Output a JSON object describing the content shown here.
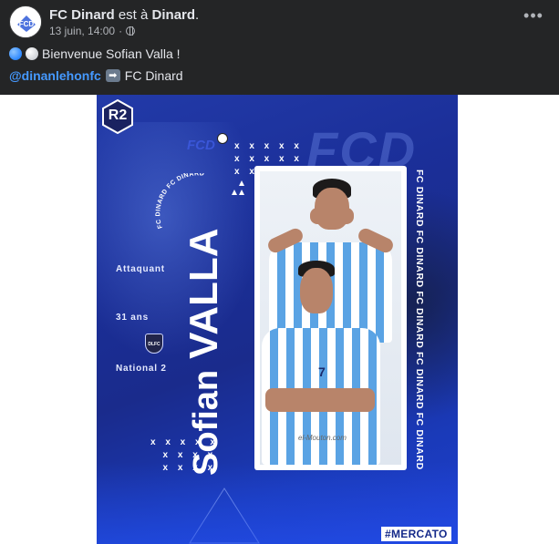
{
  "post": {
    "page_name": "FC Dinard",
    "action_text": " est à ",
    "location": "Dinard",
    "location_suffix": ".",
    "date": "13 juin, 14:00",
    "meta_sep": " · ",
    "audience_icon": "globe-icon",
    "more_icon": "more-options-icon",
    "more_label": "•••",
    "message": "Bienvenue Sofian Valla !",
    "mention": "@dinanlehonfc",
    "mention_arrow": "➡",
    "mention_target": "FC Dinard"
  },
  "poster": {
    "league_badge": "R2",
    "club_logo_small": "FCD",
    "club_logo_big": "FCD",
    "circle_text": "FC DINARD FC DINARD",
    "player_first_name": "Sofian",
    "player_last_name": "VALLA",
    "position": "Attaquant",
    "age": "31 ans",
    "previous_level": "National 2",
    "previous_club_badge": "DLFC",
    "vertical_club_text": "FC DINARD FC DINARD FC DINARD FC DINARD FC DINARD",
    "hashtag": "#MERCATO",
    "jersey_number": "7",
    "photo_watermark": "el-Mouton.com"
  },
  "colors": {
    "page_bg": "#18191a",
    "card_bg": "#242526",
    "link": "#4599ff",
    "poster_blue": "#1b2f99",
    "jersey_sky": "#5aa3e4"
  }
}
